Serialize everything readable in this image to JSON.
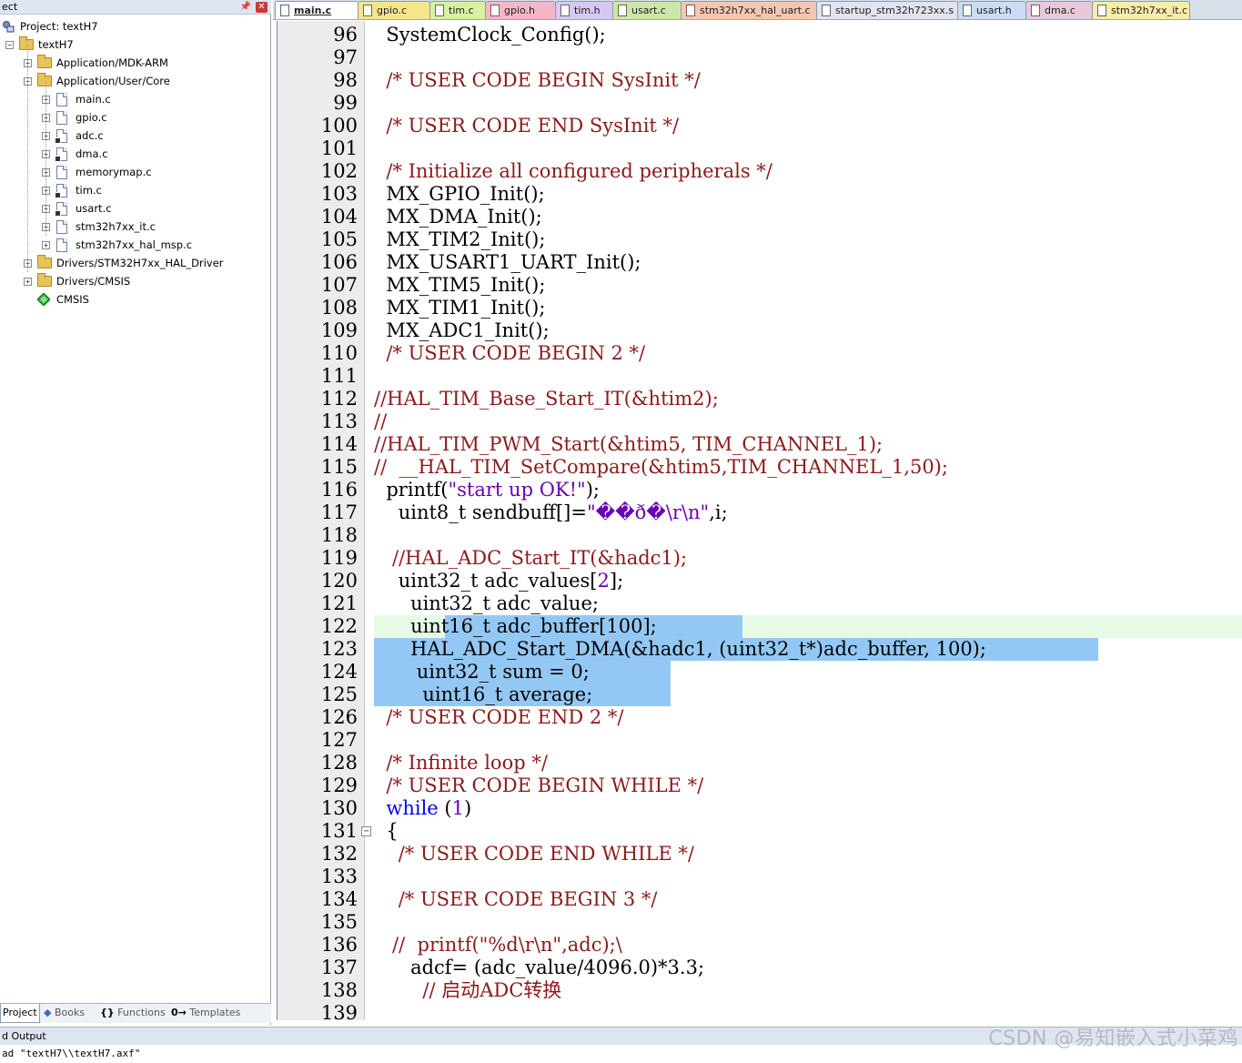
{
  "project_panel": {
    "title": "ect",
    "project_name": "Project: textH7",
    "target_name": "textH7",
    "groups": [
      {
        "label": "Application/MDK-ARM",
        "expanded": false
      },
      {
        "label": "Application/User/Core",
        "expanded": true
      }
    ],
    "core_files": [
      {
        "label": "main.c",
        "key": false
      },
      {
        "label": "gpio.c",
        "key": false
      },
      {
        "label": "adc.c",
        "key": true
      },
      {
        "label": "dma.c",
        "key": true
      },
      {
        "label": "memorymap.c",
        "key": false
      },
      {
        "label": "tim.c",
        "key": true
      },
      {
        "label": "usart.c",
        "key": true
      },
      {
        "label": "stm32h7xx_it.c",
        "key": false
      },
      {
        "label": "stm32h7xx_hal_msp.c",
        "key": false
      }
    ],
    "other_groups": [
      {
        "label": "Drivers/STM32H7xx_HAL_Driver"
      },
      {
        "label": "Drivers/CMSIS"
      }
    ],
    "cmsis_label": "CMSIS",
    "tabs": {
      "project": "Project",
      "books": "Books",
      "functions": "Functions",
      "templates": "Templates"
    }
  },
  "editor_tabs": [
    {
      "label": "main.c",
      "color": "#ffffff",
      "active": true
    },
    {
      "label": "gpio.c",
      "color": "#f6e58a"
    },
    {
      "label": "tim.c",
      "color": "#d9f0a3"
    },
    {
      "label": "gpio.h",
      "color": "#f7b6c7"
    },
    {
      "label": "tim.h",
      "color": "#d6c8f5"
    },
    {
      "label": "usart.c",
      "color": "#cde7a7"
    },
    {
      "label": "stm32h7xx_hal_uart.c",
      "color": "#f7c6b0"
    },
    {
      "label": "startup_stm32h723xx.s",
      "color": "#e3e3f0"
    },
    {
      "label": "usart.h",
      "color": "#c9ddf5"
    },
    {
      "label": "dma.c",
      "color": "#e9c9d9"
    },
    {
      "label": "stm32h7xx_it.c",
      "color": "#f9eba8"
    }
  ],
  "code": {
    "first_line": 96,
    "current_line_index": 26,
    "lines": [
      [
        [
          "  ",
          "ws"
        ],
        [
          "SystemClock_Config();",
          ""
        ]
      ],
      [],
      [
        [
          "  ",
          "ws"
        ],
        [
          "/* USER CODE BEGIN SysInit */",
          "cmt"
        ]
      ],
      [],
      [
        [
          "  ",
          "ws"
        ],
        [
          "/* USER CODE END SysInit */",
          "cmt"
        ]
      ],
      [],
      [
        [
          "  ",
          "ws"
        ],
        [
          "/* Initialize all configured peripherals */",
          "cmt"
        ]
      ],
      [
        [
          "  ",
          "ws"
        ],
        [
          "MX_GPIO_Init();",
          ""
        ]
      ],
      [
        [
          "  ",
          "ws"
        ],
        [
          "MX_DMA_Init();",
          ""
        ]
      ],
      [
        [
          "  ",
          "ws"
        ],
        [
          "MX_TIM2_Init();",
          ""
        ]
      ],
      [
        [
          "  ",
          "ws"
        ],
        [
          "MX_USART1_UART_Init();",
          ""
        ]
      ],
      [
        [
          "  ",
          "ws"
        ],
        [
          "MX_TIM5_Init();",
          ""
        ]
      ],
      [
        [
          "  ",
          "ws"
        ],
        [
          "MX_TIM1_Init();",
          ""
        ]
      ],
      [
        [
          "  ",
          "ws"
        ],
        [
          "MX_ADC1_Init();",
          ""
        ]
      ],
      [
        [
          "  ",
          "ws"
        ],
        [
          "/* USER CODE BEGIN 2 */",
          "cmt"
        ]
      ],
      [],
      [
        [
          "//HAL_TIM_Base_Start_IT(&htim2);  ",
          "cmt"
        ]
      ],
      [
        [
          "//",
          "cmt"
        ]
      ],
      [
        [
          "//HAL_TIM_PWM_Start(&htim5, TIM_CHANNEL_1);",
          "cmt"
        ]
      ],
      [
        [
          "//  __HAL_TIM_SetCompare(&htim5,TIM_CHANNEL_1,50);",
          "cmt"
        ]
      ],
      [
        [
          "  ",
          "ws"
        ],
        [
          "printf(",
          ""
        ],
        [
          "\"start up OK!\"",
          "str"
        ],
        [
          ");",
          ""
        ]
      ],
      [
        [
          "    ",
          "ws"
        ],
        [
          "uint8_t sendbuff[]=",
          ""
        ],
        [
          "\"��ð�\\r\\n\"",
          "str"
        ],
        [
          ",i;",
          ""
        ]
      ],
      [
        [
          "    ",
          "ws"
        ]
      ],
      [
        [
          "   ",
          "ws"
        ],
        [
          "//HAL_ADC_Start_IT(&hadc1);",
          "cmt"
        ]
      ],
      [
        [
          "    ",
          "ws"
        ],
        [
          "uint32_t adc_values[",
          ""
        ],
        [
          "2",
          "num"
        ],
        [
          "];",
          ""
        ]
      ],
      [
        [
          "      ",
          "ws"
        ],
        [
          "uint32_t adc_value;",
          ""
        ]
      ],
      [
        [
          "      ",
          "ws"
        ],
        [
          "uint16_t adc_buffer[100];",
          ""
        ]
      ],
      [
        [
          "      ",
          "ws"
        ],
        [
          "HAL_ADC_Start_DMA(&hadc1, (uint32_t*)adc_buffer, 100);",
          ""
        ]
      ],
      [
        [
          "       ",
          "ws"
        ],
        [
          "uint32_t sum = 0;",
          ""
        ]
      ],
      [
        [
          "        ",
          "ws"
        ],
        [
          "uint16_t average;",
          ""
        ]
      ],
      [
        [
          "  ",
          "ws"
        ],
        [
          "/* USER CODE END 2 */",
          "cmt"
        ]
      ],
      [],
      [
        [
          "  ",
          "ws"
        ],
        [
          "/* Infinite loop */",
          "cmt"
        ]
      ],
      [
        [
          "  ",
          "ws"
        ],
        [
          "/* USER CODE BEGIN WHILE */",
          "cmt"
        ]
      ],
      [
        [
          "  ",
          "ws"
        ],
        [
          "while",
          "kw"
        ],
        [
          " (",
          ""
        ],
        [
          "1",
          "num"
        ],
        [
          ")",
          ""
        ]
      ],
      [
        [
          "  ",
          "ws"
        ],
        [
          "{",
          ""
        ]
      ],
      [
        [
          "    ",
          "ws"
        ],
        [
          "/* USER CODE END WHILE */",
          "cmt"
        ]
      ],
      [],
      [
        [
          "    ",
          "ws"
        ],
        [
          "/* USER CODE BEGIN 3 */",
          "cmt"
        ]
      ],
      [
        [
          "    ",
          "ws"
        ]
      ],
      [
        [
          "   ",
          "ws"
        ],
        [
          "//  printf(\"%d\\r\\n\",adc);\\",
          "cmt"
        ]
      ],
      [
        [
          "      ",
          "ws"
        ],
        [
          "adcf= (adc_value/4096.0)*3.3;",
          ""
        ]
      ],
      [
        [
          "        ",
          "ws"
        ],
        [
          "// 启动ADC转换",
          "cmt"
        ]
      ],
      []
    ]
  },
  "output": {
    "title": "d Output",
    "text": "ad \"textH7\\\\textH7.axf\""
  },
  "watermark": "CSDN @易知嵌入式小菜鸡"
}
